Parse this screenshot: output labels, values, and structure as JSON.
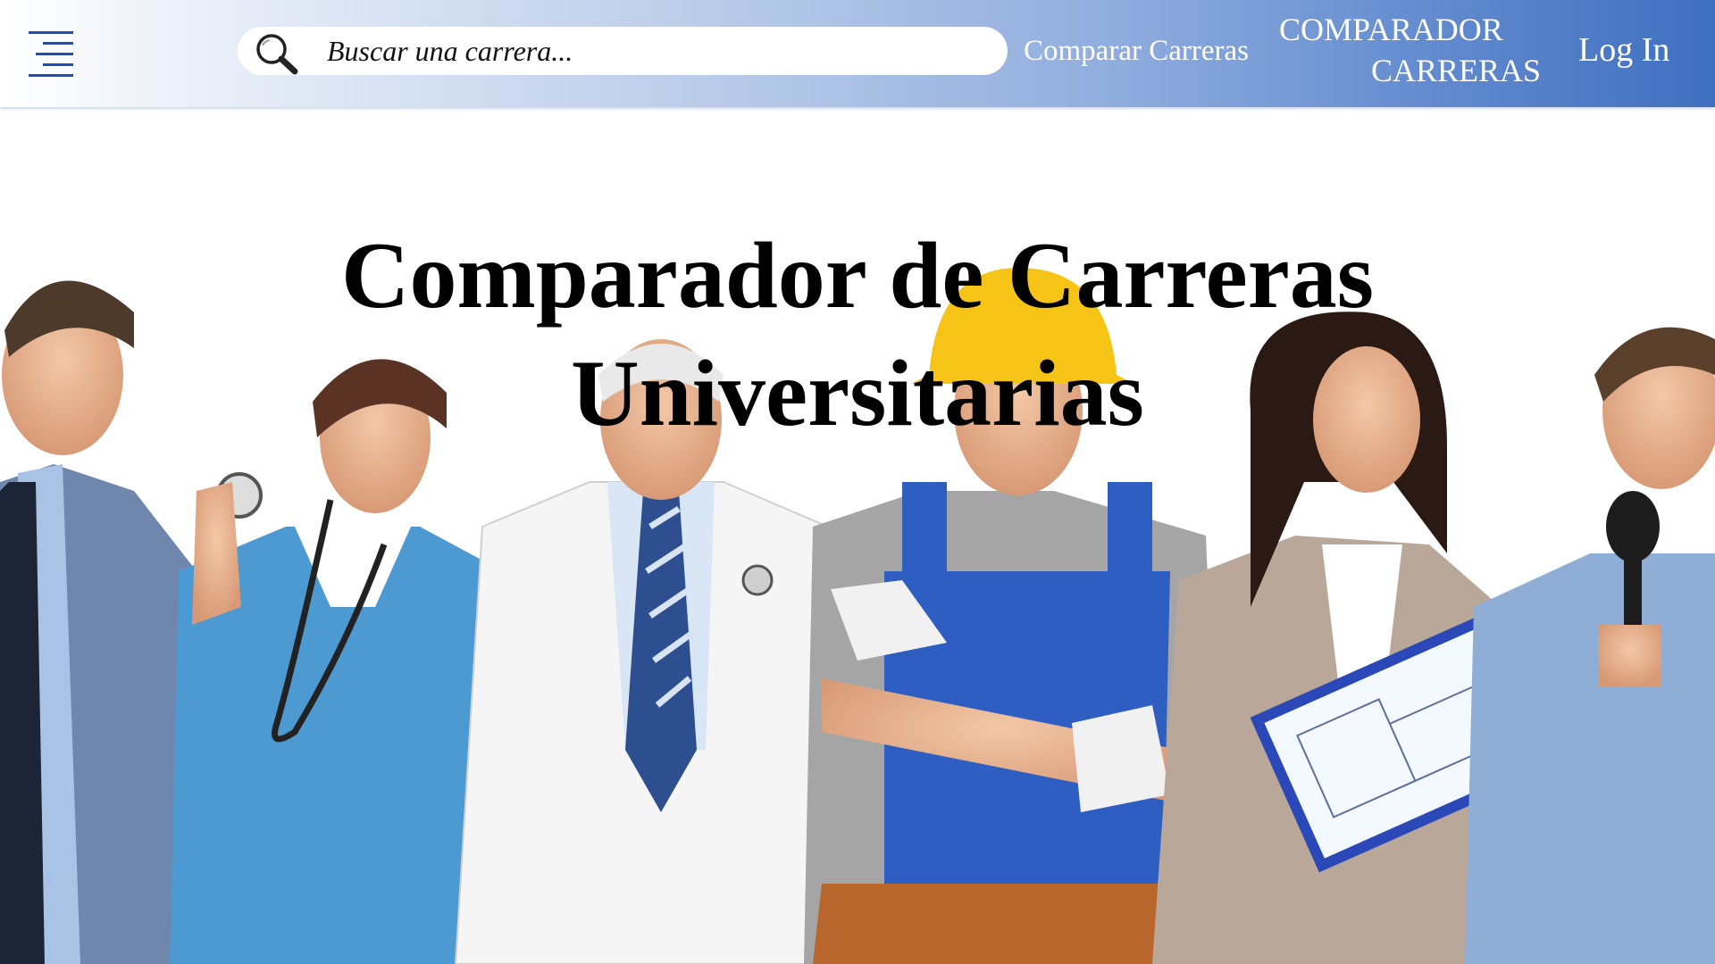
{
  "header": {
    "menu_icon": "menu-icon",
    "search": {
      "icon": "search-icon",
      "placeholder": "Buscar una carrera...",
      "value": ""
    },
    "nav": {
      "compare_label": "Comparar Carreras",
      "brand_line1": "COMPARADOR",
      "brand_line2": "CARRERAS",
      "login_label": "Log In"
    }
  },
  "hero": {
    "title_line1": "Comparador de Carreras",
    "title_line2": "Universitarias"
  },
  "colors": {
    "header_gradient_start": "#ffffff",
    "header_gradient_end": "#3f6fbf",
    "menu_icon": "#1a4fb8",
    "title": "#000000",
    "nav_text": "#ffffff"
  }
}
